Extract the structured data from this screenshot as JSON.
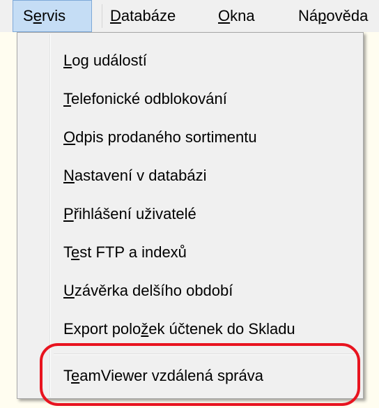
{
  "menubar": {
    "items": [
      {
        "label_pre": "S",
        "label_u": "e",
        "label_post": "rvis"
      },
      {
        "label_pre": "",
        "label_u": "D",
        "label_post": "atabáze"
      },
      {
        "label_pre": "",
        "label_u": "O",
        "label_post": "kna"
      },
      {
        "label_pre": "Ná",
        "label_u": "p",
        "label_post": "ověda"
      }
    ]
  },
  "dropdown": {
    "items": [
      {
        "label_pre": "",
        "label_u": "L",
        "label_post": "og událostí"
      },
      {
        "label_pre": "",
        "label_u": "T",
        "label_post": "elefonické odblokování"
      },
      {
        "label_pre": "",
        "label_u": "O",
        "label_post": "dpis prodaného sortimentu"
      },
      {
        "label_pre": "",
        "label_u": "N",
        "label_post": "astavení v databázi"
      },
      {
        "label_pre": "",
        "label_u": "P",
        "label_post": "řihlášení uživatelé"
      },
      {
        "label_pre": "T",
        "label_u": "e",
        "label_post": "st FTP a indexů"
      },
      {
        "label_pre": "",
        "label_u": "U",
        "label_post": "závěrka delšího období"
      },
      {
        "label_pre": "Export polo",
        "label_u": "ž",
        "label_post": "ek účtenek do Skladu"
      },
      {
        "label_pre": "T",
        "label_u": "e",
        "label_post": "amViewer vzdálená správa"
      }
    ]
  },
  "colors": {
    "highlight_ring": "#e8141f",
    "active_menu_bg": "#c5ddf5"
  }
}
